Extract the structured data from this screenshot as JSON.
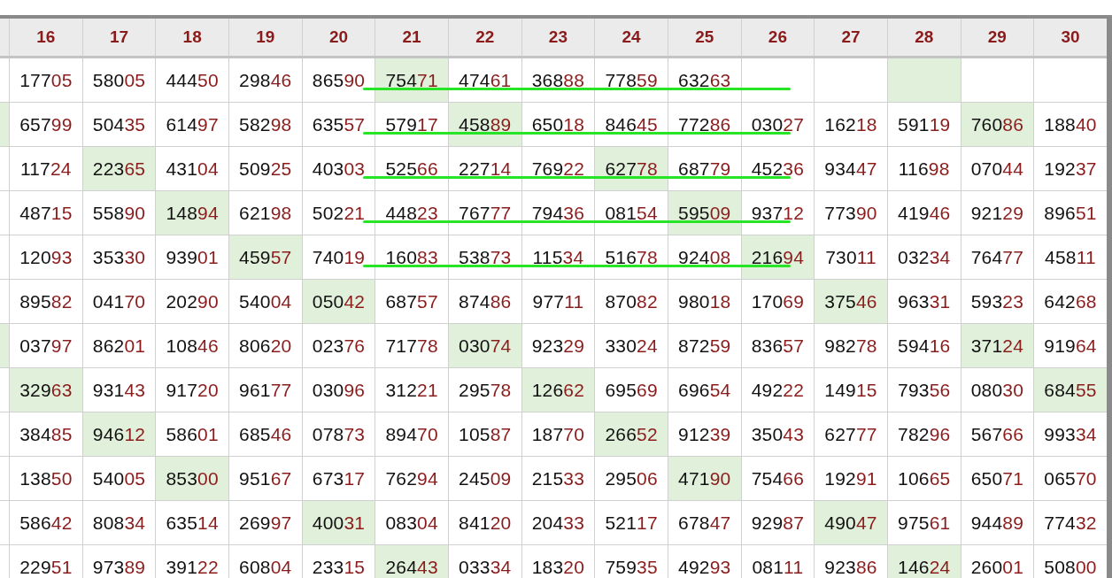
{
  "columns": [
    "16",
    "17",
    "18",
    "19",
    "20",
    "21",
    "22",
    "23",
    "24",
    "25",
    "26",
    "27",
    "28",
    "29",
    "30"
  ],
  "rows": [
    {
      "underlined": true,
      "edge_highlighted": false,
      "cells": [
        {
          "value": "17705",
          "highlighted": false
        },
        {
          "value": "58005",
          "highlighted": false
        },
        {
          "value": "44450",
          "highlighted": false
        },
        {
          "value": "29846",
          "highlighted": false
        },
        {
          "value": "86590",
          "highlighted": false
        },
        {
          "value": "75471",
          "highlighted": true
        },
        {
          "value": "47461",
          "highlighted": false
        },
        {
          "value": "36888",
          "highlighted": false
        },
        {
          "value": "77859",
          "highlighted": false
        },
        {
          "value": "63263",
          "highlighted": false
        },
        {
          "highlighted": false
        },
        {
          "highlighted": false
        },
        {
          "highlighted": true
        },
        {
          "highlighted": false
        },
        {
          "highlighted": false
        }
      ]
    },
    {
      "underlined": true,
      "edge_highlighted": true,
      "cells": [
        {
          "value": "65799",
          "highlighted": false
        },
        {
          "value": "50435",
          "highlighted": false
        },
        {
          "value": "61497",
          "highlighted": false
        },
        {
          "value": "58298",
          "highlighted": false
        },
        {
          "value": "63557",
          "highlighted": false
        },
        {
          "value": "57917",
          "highlighted": false
        },
        {
          "value": "45889",
          "highlighted": true
        },
        {
          "value": "65018",
          "highlighted": false
        },
        {
          "value": "84645",
          "highlighted": false
        },
        {
          "value": "77286",
          "highlighted": false
        },
        {
          "value": "03027",
          "highlighted": false
        },
        {
          "value": "16218",
          "highlighted": false
        },
        {
          "value": "59119",
          "highlighted": false
        },
        {
          "value": "76086",
          "highlighted": true
        },
        {
          "value": "18840",
          "highlighted": false
        }
      ]
    },
    {
      "underlined": true,
      "edge_highlighted": false,
      "cells": [
        {
          "value": "11724",
          "highlighted": false
        },
        {
          "value": "22365",
          "highlighted": true
        },
        {
          "value": "43104",
          "highlighted": false
        },
        {
          "value": "50925",
          "highlighted": false
        },
        {
          "value": "40303",
          "highlighted": false
        },
        {
          "value": "52566",
          "highlighted": false
        },
        {
          "value": "22714",
          "highlighted": false
        },
        {
          "value": "76922",
          "highlighted": false
        },
        {
          "value": "62778",
          "highlighted": true
        },
        {
          "value": "68779",
          "highlighted": false
        },
        {
          "value": "45236",
          "highlighted": false
        },
        {
          "value": "93447",
          "highlighted": false
        },
        {
          "value": "11698",
          "highlighted": false
        },
        {
          "value": "07044",
          "highlighted": false
        },
        {
          "value": "19237",
          "highlighted": false
        }
      ]
    },
    {
      "underlined": true,
      "edge_highlighted": false,
      "cells": [
        {
          "value": "48715",
          "highlighted": false
        },
        {
          "value": "55890",
          "highlighted": false
        },
        {
          "value": "14894",
          "highlighted": true
        },
        {
          "value": "62198",
          "highlighted": false
        },
        {
          "value": "50221",
          "highlighted": false
        },
        {
          "value": "44823",
          "highlighted": false
        },
        {
          "value": "76777",
          "highlighted": false
        },
        {
          "value": "79436",
          "highlighted": false
        },
        {
          "value": "08154",
          "highlighted": false
        },
        {
          "value": "59509",
          "highlighted": true
        },
        {
          "value": "93712",
          "highlighted": false
        },
        {
          "value": "77390",
          "highlighted": false
        },
        {
          "value": "41946",
          "highlighted": false
        },
        {
          "value": "92129",
          "highlighted": false
        },
        {
          "value": "89651",
          "highlighted": false
        }
      ]
    },
    {
      "underlined": true,
      "edge_highlighted": false,
      "cells": [
        {
          "value": "12093",
          "highlighted": false
        },
        {
          "value": "35330",
          "highlighted": false
        },
        {
          "value": "93901",
          "highlighted": false
        },
        {
          "value": "45957",
          "highlighted": true
        },
        {
          "value": "74019",
          "highlighted": false
        },
        {
          "value": "16083",
          "highlighted": false
        },
        {
          "value": "53873",
          "highlighted": false
        },
        {
          "value": "11534",
          "highlighted": false
        },
        {
          "value": "51678",
          "highlighted": false
        },
        {
          "value": "92408",
          "highlighted": false
        },
        {
          "value": "21694",
          "highlighted": true
        },
        {
          "value": "73011",
          "highlighted": false
        },
        {
          "value": "03234",
          "highlighted": false
        },
        {
          "value": "76477",
          "highlighted": false
        },
        {
          "value": "45811",
          "highlighted": false
        }
      ]
    },
    {
      "underlined": false,
      "edge_highlighted": false,
      "cells": [
        {
          "value": "89582",
          "highlighted": false
        },
        {
          "value": "04170",
          "highlighted": false
        },
        {
          "value": "20290",
          "highlighted": false
        },
        {
          "value": "54004",
          "highlighted": false
        },
        {
          "value": "05042",
          "highlighted": true
        },
        {
          "value": "68757",
          "highlighted": false
        },
        {
          "value": "87486",
          "highlighted": false
        },
        {
          "value": "97711",
          "highlighted": false
        },
        {
          "value": "87082",
          "highlighted": false
        },
        {
          "value": "98018",
          "highlighted": false
        },
        {
          "value": "17069",
          "highlighted": false
        },
        {
          "value": "37546",
          "highlighted": true
        },
        {
          "value": "96331",
          "highlighted": false
        },
        {
          "value": "59323",
          "highlighted": false
        },
        {
          "value": "64268",
          "highlighted": false
        }
      ]
    },
    {
      "underlined": false,
      "edge_highlighted": true,
      "cells": [
        {
          "value": "03797",
          "highlighted": false
        },
        {
          "value": "86201",
          "highlighted": false
        },
        {
          "value": "10846",
          "highlighted": false
        },
        {
          "value": "80620",
          "highlighted": false
        },
        {
          "value": "02376",
          "highlighted": false
        },
        {
          "value": "71778",
          "highlighted": false
        },
        {
          "value": "03074",
          "highlighted": true
        },
        {
          "value": "92329",
          "highlighted": false
        },
        {
          "value": "33024",
          "highlighted": false
        },
        {
          "value": "87259",
          "highlighted": false
        },
        {
          "value": "83657",
          "highlighted": false
        },
        {
          "value": "98278",
          "highlighted": false
        },
        {
          "value": "59416",
          "highlighted": false
        },
        {
          "value": "37124",
          "highlighted": true
        },
        {
          "value": "91964",
          "highlighted": false
        }
      ]
    },
    {
      "underlined": false,
      "edge_highlighted": false,
      "cells": [
        {
          "value": "32963",
          "highlighted": true
        },
        {
          "value": "93143",
          "highlighted": false
        },
        {
          "value": "91720",
          "highlighted": false
        },
        {
          "value": "96177",
          "highlighted": false
        },
        {
          "value": "03096",
          "highlighted": false
        },
        {
          "value": "31221",
          "highlighted": false
        },
        {
          "value": "29578",
          "highlighted": false
        },
        {
          "value": "12662",
          "highlighted": true
        },
        {
          "value": "69569",
          "highlighted": false
        },
        {
          "value": "69654",
          "highlighted": false
        },
        {
          "value": "49222",
          "highlighted": false
        },
        {
          "value": "14915",
          "highlighted": false
        },
        {
          "value": "79356",
          "highlighted": false
        },
        {
          "value": "08030",
          "highlighted": false
        },
        {
          "value": "68455",
          "highlighted": true
        }
      ]
    },
    {
      "underlined": false,
      "edge_highlighted": false,
      "cells": [
        {
          "value": "38485",
          "highlighted": false
        },
        {
          "value": "94612",
          "highlighted": true
        },
        {
          "value": "58601",
          "highlighted": false
        },
        {
          "value": "68546",
          "highlighted": false
        },
        {
          "value": "07873",
          "highlighted": false
        },
        {
          "value": "89470",
          "highlighted": false
        },
        {
          "value": "10587",
          "highlighted": false
        },
        {
          "value": "18770",
          "highlighted": false
        },
        {
          "value": "26652",
          "highlighted": true
        },
        {
          "value": "91239",
          "highlighted": false
        },
        {
          "value": "35043",
          "highlighted": false
        },
        {
          "value": "62777",
          "highlighted": false
        },
        {
          "value": "78296",
          "highlighted": false
        },
        {
          "value": "56766",
          "highlighted": false
        },
        {
          "value": "99334",
          "highlighted": false
        }
      ]
    },
    {
      "underlined": false,
      "edge_highlighted": false,
      "cells": [
        {
          "value": "13850",
          "highlighted": false
        },
        {
          "value": "54005",
          "highlighted": false
        },
        {
          "value": "85300",
          "highlighted": true
        },
        {
          "value": "95167",
          "highlighted": false
        },
        {
          "value": "67317",
          "highlighted": false
        },
        {
          "value": "76294",
          "highlighted": false
        },
        {
          "value": "24509",
          "highlighted": false
        },
        {
          "value": "21533",
          "highlighted": false
        },
        {
          "value": "29506",
          "highlighted": false
        },
        {
          "value": "47190",
          "highlighted": true
        },
        {
          "value": "75466",
          "highlighted": false
        },
        {
          "value": "19291",
          "highlighted": false
        },
        {
          "value": "10665",
          "highlighted": false
        },
        {
          "value": "65071",
          "highlighted": false
        },
        {
          "value": "06570",
          "highlighted": false
        }
      ]
    },
    {
      "underlined": false,
      "edge_highlighted": false,
      "cells": [
        {
          "value": "58642",
          "highlighted": false
        },
        {
          "value": "80834",
          "highlighted": false
        },
        {
          "value": "63514",
          "highlighted": false
        },
        {
          "value": "26997",
          "highlighted": false
        },
        {
          "value": "40031",
          "highlighted": true
        },
        {
          "value": "08304",
          "highlighted": false
        },
        {
          "value": "84120",
          "highlighted": false
        },
        {
          "value": "20433",
          "highlighted": false
        },
        {
          "value": "52117",
          "highlighted": false
        },
        {
          "value": "67847",
          "highlighted": false
        },
        {
          "value": "92987",
          "highlighted": false
        },
        {
          "value": "49047",
          "highlighted": true
        },
        {
          "value": "97561",
          "highlighted": false
        },
        {
          "value": "94489",
          "highlighted": false
        },
        {
          "value": "77432",
          "highlighted": false
        }
      ]
    },
    {
      "underlined": false,
      "edge_highlighted": false,
      "cells": [
        {
          "value": "22951",
          "highlighted": false
        },
        {
          "value": "97389",
          "highlighted": false
        },
        {
          "value": "39122",
          "highlighted": false
        },
        {
          "value": "60804",
          "highlighted": false
        },
        {
          "value": "23315",
          "highlighted": false
        },
        {
          "value": "26443",
          "highlighted": true
        },
        {
          "value": "03334",
          "highlighted": false
        },
        {
          "value": "18320",
          "highlighted": false
        },
        {
          "value": "75935",
          "highlighted": false
        },
        {
          "value": "49293",
          "highlighted": false
        },
        {
          "value": "08111",
          "highlighted": false
        },
        {
          "value": "92386",
          "highlighted": false
        },
        {
          "value": "14624",
          "highlighted": true
        },
        {
          "value": "26001",
          "highlighted": false
        },
        {
          "value": "50800",
          "highlighted": false
        }
      ]
    }
  ]
}
